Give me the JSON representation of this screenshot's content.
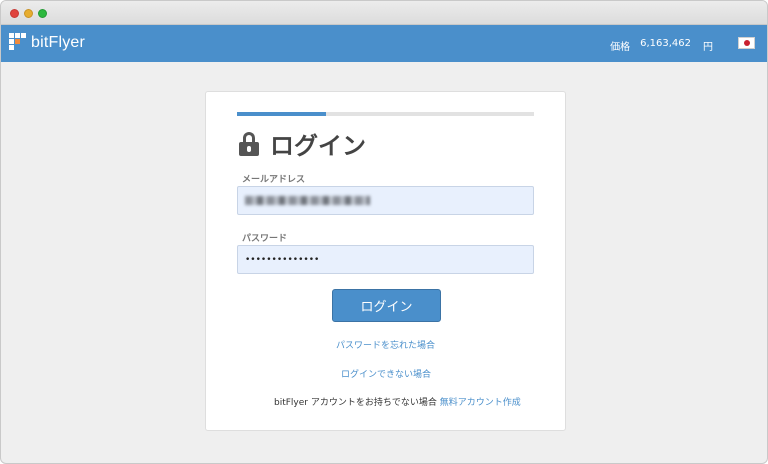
{
  "header": {
    "brand": "bitFlyer",
    "price_label": "価格",
    "price_value": "6,163,462",
    "price_unit": "円",
    "flag_icon": "japan-flag-icon"
  },
  "login": {
    "title": "ログイン",
    "progress": 0.3,
    "email_label": "メールアドレス",
    "password_label": "パスワード",
    "password_value": "••••••••••••••",
    "submit_label": "ログイン",
    "forgot_password": "パスワードを忘れた場合",
    "cannot_login": "ログインできない場合",
    "no_account_text": "bitFlyer アカウントをお持ちでない場合",
    "create_account": "無料アカウント作成"
  },
  "colors": {
    "primary": "#4a8fcb",
    "field_bg": "#e8f0fd"
  }
}
